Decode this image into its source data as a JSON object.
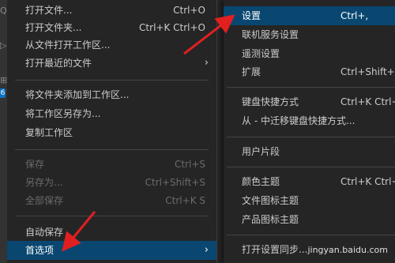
{
  "activity_bar": {
    "glyphs": [
      "Q",
      "▷",
      "⊞",
      "6"
    ]
  },
  "file_menu": {
    "items": [
      {
        "label": "打开文件...",
        "shortcut": "Ctrl+O"
      },
      {
        "label": "打开文件夹...",
        "shortcut": "Ctrl+K Ctrl+O"
      },
      {
        "label": "从文件打开工作区...",
        "shortcut": ""
      },
      {
        "label": "打开最近的文件",
        "shortcut": "",
        "submenu": "›"
      },
      {
        "label": "将文件夹添加到工作区...",
        "shortcut": ""
      },
      {
        "label": "将工作区另存为...",
        "shortcut": ""
      },
      {
        "label": "复制工作区",
        "shortcut": ""
      },
      {
        "label": "保存",
        "shortcut": "Ctrl+S",
        "disabled": true
      },
      {
        "label": "另存为...",
        "shortcut": "Ctrl+Shift+S",
        "disabled": true
      },
      {
        "label": "全部保存",
        "shortcut": "Ctrl+K S",
        "disabled": true
      },
      {
        "label": "自动保存",
        "shortcut": ""
      },
      {
        "label": "首选项",
        "shortcut": "",
        "submenu": "›",
        "selected": true
      }
    ]
  },
  "preferences_menu": {
    "items": [
      {
        "label": "设置",
        "shortcut": "Ctrl+,",
        "selected": true
      },
      {
        "label": "联机服务设置",
        "shortcut": ""
      },
      {
        "label": "遥测设置",
        "shortcut": ""
      },
      {
        "label": "扩展",
        "shortcut": "Ctrl+Shift+X"
      },
      {
        "label": "键盘快捷方式",
        "shortcut": "Ctrl+K Ctrl+S"
      },
      {
        "label": "从 - 中迁移键盘快捷方式...",
        "shortcut": ""
      },
      {
        "label": "用户片段",
        "shortcut": ""
      },
      {
        "label": "颜色主题",
        "shortcut": "Ctrl+K Ctrl+T"
      },
      {
        "label": "文件图标主题",
        "shortcut": ""
      },
      {
        "label": "产品图标主题",
        "shortcut": ""
      },
      {
        "label": "打开设置同步...",
        "shortcut": ""
      }
    ]
  },
  "watermark": "jingyan.baidu.com",
  "colors": {
    "menu_bg": "#252526",
    "selection": "#094771",
    "annotation_arrow": "#e02020"
  }
}
